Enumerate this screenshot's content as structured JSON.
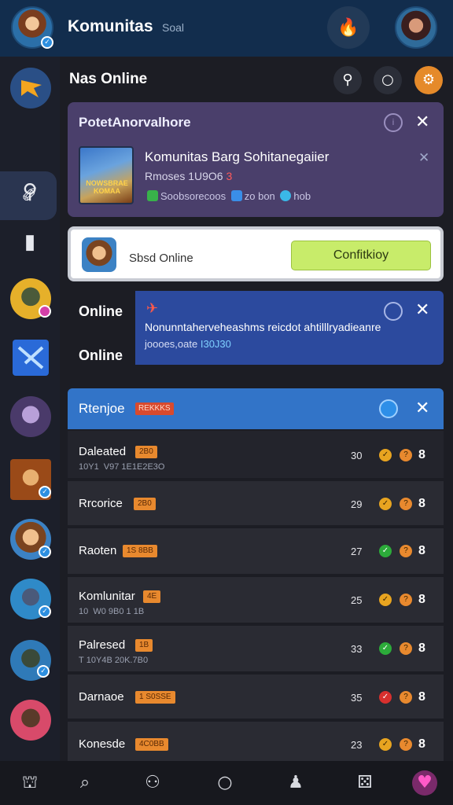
{
  "topbar": {
    "title": "Komunitas",
    "subtitle": "Soal",
    "icon": "flame-icon"
  },
  "header": {
    "title": "Nas Online"
  },
  "notification": {
    "title": "PotetAnorvalhore",
    "game_label": "NOWSBRAE KOMAA",
    "game_title": "Komunitas Barg Sohitanegaiier",
    "meta_text": "Rmoses 1U9O6",
    "meta_mark": "3",
    "row_text_a": "Soobsorecoos",
    "row_text_b": "zo bon",
    "row_text_c": "hob"
  },
  "status_card": {
    "label": "Sbsd Online",
    "button_label": "Confitkioy"
  },
  "online_labels": [
    "Online",
    "Online"
  ],
  "blue_card": {
    "text": "Nonunntaherveheashms reicdot ahtilllryadieanre",
    "sub_prefix": "joooes,oate",
    "sub_highlight": "I30J30"
  },
  "list": {
    "title": "Rtenjoe",
    "title_badge": "REKKKS",
    "rows": [
      {
        "name": "Daleated",
        "badge": "2B0",
        "sub": "10Y1  V97 1E1E2E3O",
        "num": "30",
        "dot1": "orange",
        "dot2": "orange",
        "end": "8"
      },
      {
        "name": "Rrcorice",
        "badge": "2B0",
        "sub": "",
        "num": "29",
        "dot1": "orange",
        "dot2": "orange",
        "end": "8"
      },
      {
        "name": "Raoten",
        "badge": "1S 8BB",
        "sub": "",
        "num": "27",
        "dot1": "green",
        "dot2": "orange",
        "end": "8"
      },
      {
        "name": "Komlunitar",
        "badge": "4E",
        "sub": "10  W0 9B0 1 1B",
        "num": "25",
        "dot1": "orange",
        "dot2": "orange",
        "end": "8"
      },
      {
        "name": "Palresed",
        "badge": "1B",
        "sub": "T 10Y4B 20K.7B0",
        "num": "33",
        "dot1": "green",
        "dot2": "orange",
        "end": "8"
      },
      {
        "name": "Darnaoe",
        "badge": "1 S0SSE",
        "sub": "",
        "num": "35",
        "dot1": "red",
        "dot2": "orange",
        "end": "8"
      },
      {
        "name": "Konesde",
        "badge": "4C0BB",
        "sub": "",
        "num": "23",
        "dot1": "orange",
        "dot2": "orange",
        "end": "8"
      }
    ]
  },
  "colors": {
    "topbar": "#122d4d",
    "purple_card": "#4a3f6b",
    "blue_card": "#2c4a9e",
    "list_header": "#3274c8",
    "accent_orange": "#e8892e",
    "confirm_button": "#c8ec6a",
    "dot_orange": "#e8a420",
    "dot_green": "#2cab3a",
    "dot_red": "#d8302e"
  }
}
